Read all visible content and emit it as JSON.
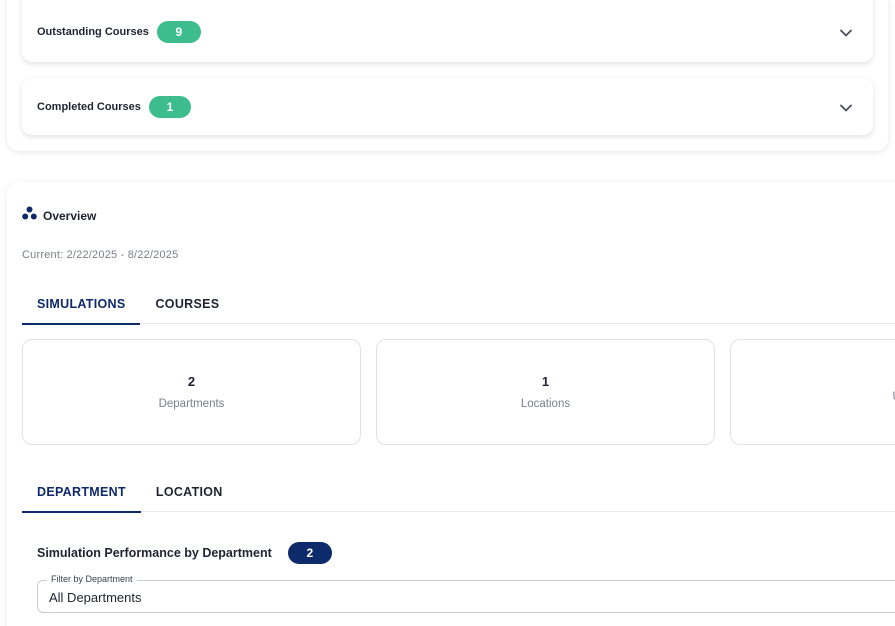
{
  "courses": {
    "outstanding": {
      "label": "Outstanding Courses",
      "count": "9"
    },
    "completed": {
      "label": "Completed Courses",
      "count": "1"
    }
  },
  "overview": {
    "title": "Overview",
    "current_range": "Current: 2/22/2025 - 8/22/2025",
    "tabs": [
      {
        "label": "SIMULATIONS",
        "active": true
      },
      {
        "label": "COURSES",
        "active": false
      }
    ],
    "stats": [
      {
        "value": "2",
        "label": "Departments"
      },
      {
        "value": "1",
        "label": "Locations"
      },
      {
        "value": "",
        "label": "Us"
      }
    ],
    "sub_tabs": [
      {
        "label": "DEPARTMENT",
        "active": true
      },
      {
        "label": "LOCATION",
        "active": false
      }
    ],
    "performance": {
      "title": "Simulation Performance by Department",
      "count": "2"
    },
    "filter": {
      "legend": "Filter by Department",
      "value": "All Departments"
    }
  },
  "colors": {
    "accent_green": "#3dbd8e",
    "navy": "#0d2a6b",
    "muted_text": "#7a7f89"
  }
}
